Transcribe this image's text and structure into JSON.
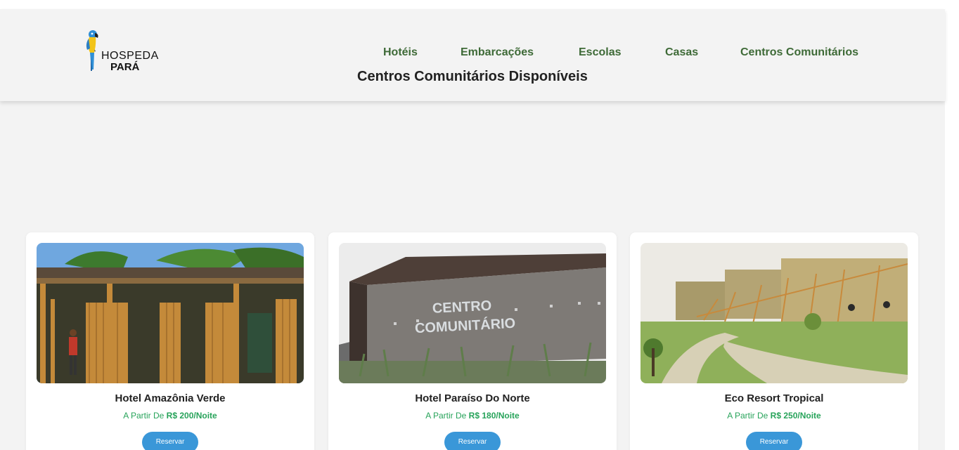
{
  "logo": {
    "line1": "HOSPEDA",
    "line2": "PARÁ",
    "icon": "macaw-parrot-icon"
  },
  "nav": {
    "items": [
      {
        "label": "Hotéis"
      },
      {
        "label": "Embarcações"
      },
      {
        "label": "Escolas"
      },
      {
        "label": "Casas"
      },
      {
        "label": "Centros Comunitários"
      }
    ]
  },
  "page_title": "Centros Comunitários Disponíveis",
  "cards": [
    {
      "name": "Hotel Amazônia Verde",
      "price_prefix": "A Partir De",
      "price_value": "R$ 200/Noite",
      "button": "Reservar",
      "image": "bamboo-hut-photo"
    },
    {
      "name": "Hotel Paraíso Do Norte",
      "price_prefix": "A Partir De",
      "price_value": "R$ 180/Noite",
      "button": "Reservar",
      "image": "centro-comunitario-building-photo"
    },
    {
      "name": "Eco Resort Tropical",
      "price_prefix": "A Partir De",
      "price_value": "R$ 250/Noite",
      "button": "Reservar",
      "image": "eco-resort-building-photo"
    }
  ],
  "photo_text": {
    "sign_line1": "CENTRO",
    "sign_line2": "COMUNITÁRIO"
  },
  "colors": {
    "nav_link": "#3e6a37",
    "price": "#27a35a",
    "button": "#3a97d8"
  }
}
